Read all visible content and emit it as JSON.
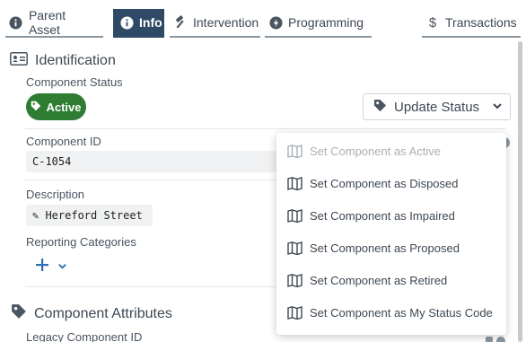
{
  "tabs": [
    {
      "label": "Parent Asset",
      "icon": "info-circle-icon"
    },
    {
      "label": "Info",
      "icon": "info-circle-icon",
      "active": true
    },
    {
      "label": "Intervention",
      "icon": "hammer-icon"
    },
    {
      "label": "Programming",
      "icon": "bolt-icon"
    },
    {
      "label": "Transactions",
      "icon": "dollar-icon"
    }
  ],
  "identification": {
    "heading": "Identification",
    "status_label": "Component Status",
    "status_value": "Active",
    "update_button": "Update Status",
    "id_label": "Component ID",
    "id_value": "C-1054",
    "description_label": "Description",
    "description_value": "✎ Hereford Street",
    "reporting_label": "Reporting Categories"
  },
  "attributes": {
    "heading": "Component Attributes",
    "legacy_label": "Legacy Component ID"
  },
  "status_menu": {
    "items": [
      {
        "label": "Set Component as Active",
        "disabled": true
      },
      {
        "label": "Set Component as Disposed"
      },
      {
        "label": "Set Component as Impaired"
      },
      {
        "label": "Set Component as Proposed"
      },
      {
        "label": "Set Component as Retired"
      },
      {
        "label": "Set Component as My Status Code"
      }
    ]
  },
  "colors": {
    "active_tab": "#2f4a66",
    "active_badge": "#2e7d32",
    "text": "#3d4853"
  }
}
